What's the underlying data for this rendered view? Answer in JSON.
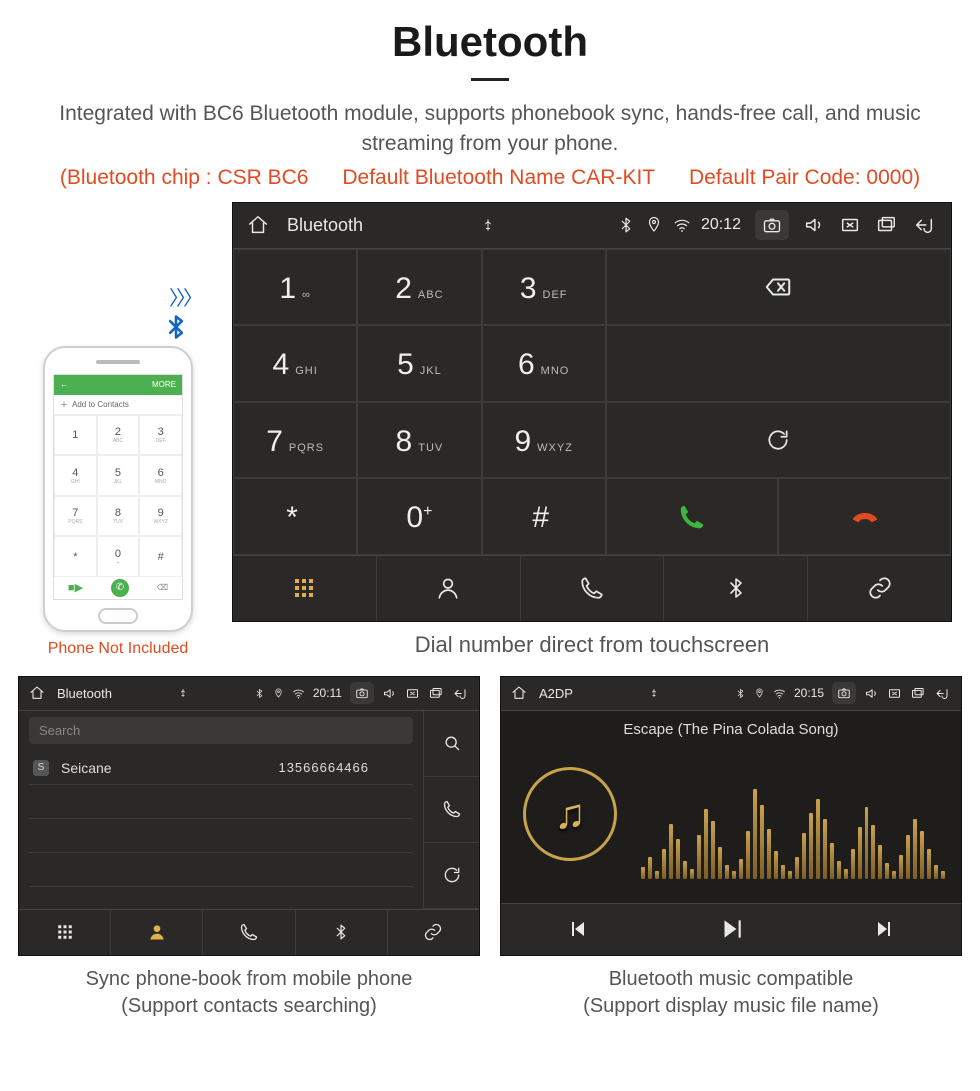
{
  "header": {
    "title": "Bluetooth"
  },
  "desc": "Integrated with BC6 Bluetooth module, supports phonebook sync, hands-free call, and music streaming from your phone.",
  "red": {
    "chip": "(Bluetooth chip : CSR BC6",
    "name": "Default Bluetooth Name CAR-KIT",
    "code": "Default Pair Code: 0000)"
  },
  "phone": {
    "add_contacts": "Add to Contacts",
    "topbar_back": "←",
    "topbar_more": "MORE",
    "keys": [
      "1",
      "2",
      "3",
      "4",
      "5",
      "6",
      "7",
      "8",
      "9",
      "*",
      "0",
      "#"
    ],
    "sub": [
      "",
      "ABC",
      "DEF",
      "GHI",
      "JKL",
      "MNO",
      "PQRS",
      "TUV",
      "WXYZ",
      "",
      "+",
      ""
    ],
    "caption": "Phone Not Included"
  },
  "main": {
    "top_title": "Bluetooth",
    "time": "20:12",
    "keys": [
      {
        "n": "1",
        "l": "∞"
      },
      {
        "n": "2",
        "l": "ABC"
      },
      {
        "n": "3",
        "l": "DEF"
      },
      {
        "n": "4",
        "l": "GHI"
      },
      {
        "n": "5",
        "l": "JKL"
      },
      {
        "n": "6",
        "l": "MNO"
      },
      {
        "n": "7",
        "l": "PQRS"
      },
      {
        "n": "8",
        "l": "TUV"
      },
      {
        "n": "9",
        "l": "WXYZ"
      },
      {
        "n": "*",
        "l": ""
      },
      {
        "n": "0",
        "l": "+",
        "sup": true
      },
      {
        "n": "#",
        "l": ""
      }
    ],
    "caption": "Dial number direct from touchscreen"
  },
  "contacts": {
    "top_title": "Bluetooth",
    "time": "20:11",
    "search_placeholder": "Search",
    "tag": "S",
    "name": "Seicane",
    "number": "13566664466",
    "caption1": "Sync phone-book from mobile phone",
    "caption2": "(Support contacts searching)"
  },
  "music": {
    "top_title": "A2DP",
    "time": "20:15",
    "song": "Escape (The Pina Colada Song)",
    "caption1": "Bluetooth music compatible",
    "caption2": "(Support display music file name)"
  }
}
